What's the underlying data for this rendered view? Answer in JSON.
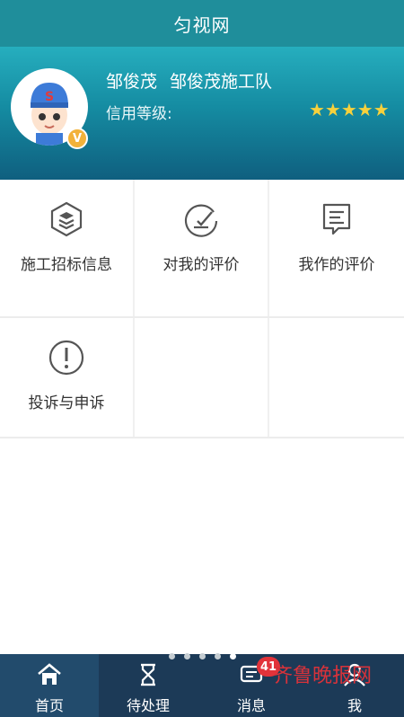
{
  "app": {
    "title": "匀视网"
  },
  "profile": {
    "name": "邹俊茂",
    "team": "邹俊茂施工队",
    "credit_label": "信用等级:",
    "stars": "★★★★★",
    "verified_badge": "V"
  },
  "menu": {
    "items": [
      {
        "label": "施工招标信息",
        "icon": "layers-hex-icon"
      },
      {
        "label": "对我的评价",
        "icon": "edit-circle-icon"
      },
      {
        "label": "我作的评价",
        "icon": "comment-doc-icon"
      },
      {
        "label": "投诉与申诉",
        "icon": "exclamation-circle-icon"
      }
    ]
  },
  "tabbar": {
    "tabs": [
      {
        "label": "首页",
        "icon": "home-icon"
      },
      {
        "label": "待处理",
        "icon": "hourglass-icon"
      },
      {
        "label": "消息",
        "icon": "message-icon"
      },
      {
        "label": "我",
        "icon": "user-icon"
      }
    ],
    "message_badge": "41"
  },
  "watermark": {
    "text": "齐鲁晚报网"
  },
  "colors": {
    "header": "#1f8e9b",
    "tabbar": "#1c3a57",
    "star": "#f7d13c",
    "badge": "#e2333a"
  }
}
